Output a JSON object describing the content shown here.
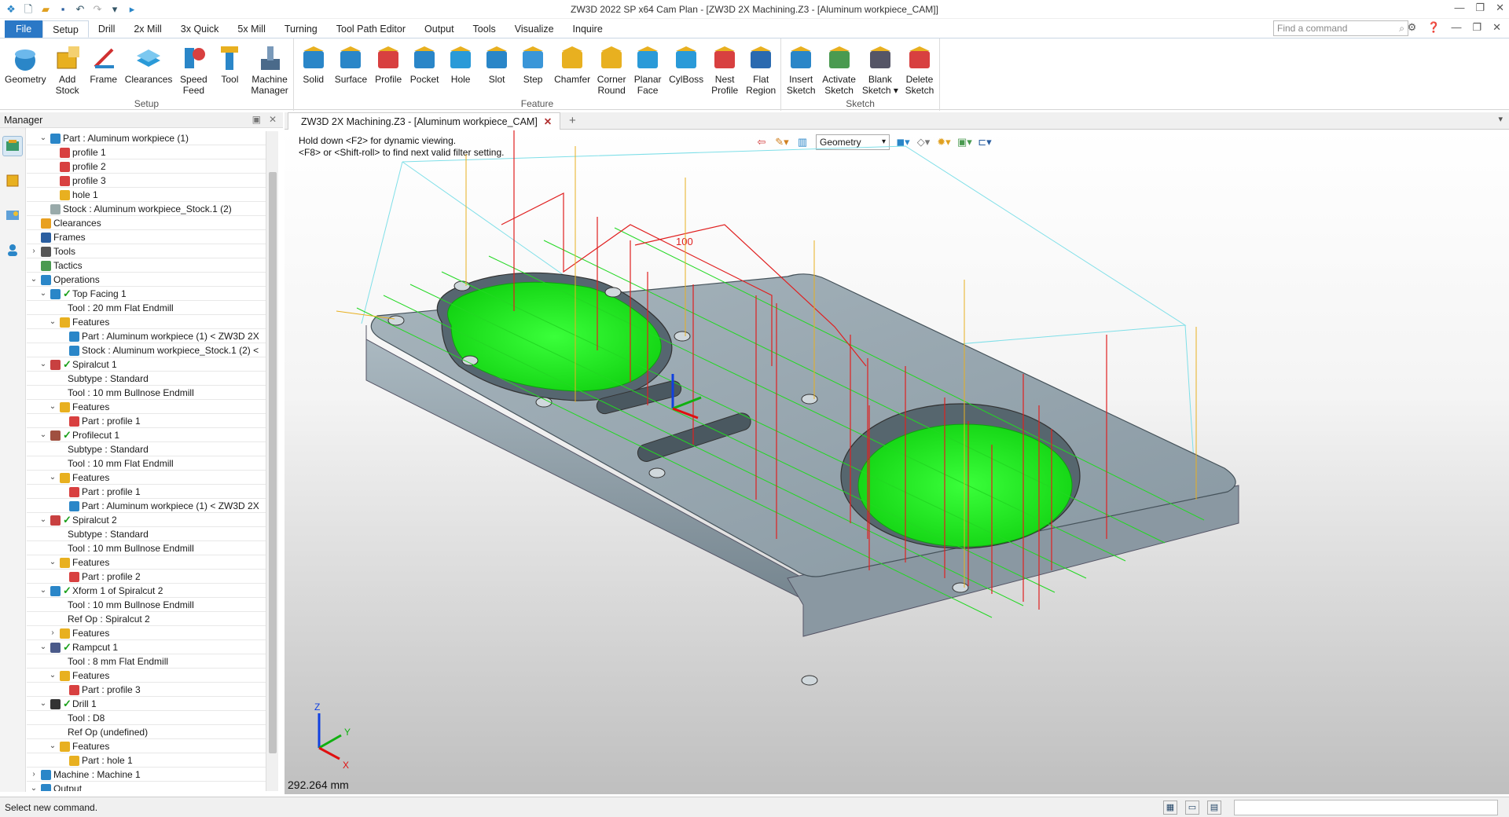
{
  "app": {
    "title": "ZW3D 2022 SP x64          Cam Plan - [ZW3D 2X Machining.Z3 - [Aluminum workpiece_CAM]]"
  },
  "quick_access": [
    "new-file-icon",
    "open-folder-icon",
    "save-icon",
    "undo-icon",
    "redo-icon",
    "dropdown-icon",
    "run-icon"
  ],
  "menu": {
    "tabs": [
      "File",
      "Setup",
      "Drill",
      "2x Mill",
      "3x Quick",
      "5x Mill",
      "Turning",
      "Tool Path Editor",
      "Output",
      "Tools",
      "Visualize",
      "Inquire"
    ],
    "active": "Setup"
  },
  "command_search": {
    "placeholder": "Find a command"
  },
  "ribbon": {
    "groups": [
      {
        "name": "Setup",
        "buttons": [
          "Geometry",
          "Add\nStock",
          "Frame",
          "Clearances",
          "Speed\nFeed",
          "Tool",
          "Machine\nManager"
        ]
      },
      {
        "name": "Feature",
        "buttons": [
          "Solid",
          "Surface",
          "Profile",
          "Pocket",
          "Hole",
          "Slot",
          "Step",
          "Chamfer",
          "Corner\nRound",
          "Planar\nFace",
          "CylBoss",
          "Nest\nProfile",
          "Flat\nRegion"
        ]
      },
      {
        "name": "Sketch",
        "buttons": [
          "Insert\nSketch",
          "Activate\nSketch",
          "Blank\nSketch ▾",
          "Delete\nSketch"
        ]
      }
    ],
    "colors": {
      "primary": "#2a86c8",
      "accent": "#e8a020",
      "sketch": "#d84040"
    }
  },
  "manager": {
    "title": "Manager",
    "tree": [
      {
        "depth": 1,
        "exp": "v",
        "icon": "part",
        "label": "Part : Aluminum workpiece (1)"
      },
      {
        "depth": 2,
        "icon": "profile",
        "label": "profile 1"
      },
      {
        "depth": 2,
        "icon": "profile",
        "label": "profile 2"
      },
      {
        "depth": 2,
        "icon": "profile",
        "label": "profile 3"
      },
      {
        "depth": 2,
        "icon": "hole",
        "label": "hole 1"
      },
      {
        "depth": 1,
        "icon": "stock",
        "label": "Stock : Aluminum workpiece_Stock.1 (2)"
      },
      {
        "depth": 0,
        "icon": "clearance",
        "label": "Clearances"
      },
      {
        "depth": 0,
        "icon": "frame",
        "label": "Frames"
      },
      {
        "depth": 0,
        "exp": ">",
        "icon": "tool",
        "label": "Tools"
      },
      {
        "depth": 0,
        "icon": "tactic",
        "label": "Tactics"
      },
      {
        "depth": 0,
        "exp": "v",
        "icon": "ops",
        "label": "Operations"
      },
      {
        "depth": 1,
        "exp": "v",
        "icon": "facing",
        "check": true,
        "label": "Top Facing 1"
      },
      {
        "depth": 2,
        "label": "Tool : 20 mm Flat Endmill"
      },
      {
        "depth": 2,
        "exp": "v",
        "icon": "feature",
        "label": "Features"
      },
      {
        "depth": 3,
        "icon": "part",
        "label": "Part : Aluminum workpiece (1) < ZW3D 2X"
      },
      {
        "depth": 3,
        "icon": "part",
        "label": "Stock : Aluminum workpiece_Stock.1 (2) <"
      },
      {
        "depth": 1,
        "exp": "v",
        "icon": "spiral",
        "check": true,
        "label": "Spiralcut 1"
      },
      {
        "depth": 2,
        "label": "Subtype : Standard"
      },
      {
        "depth": 2,
        "label": "Tool : 10 mm Bullnose Endmill"
      },
      {
        "depth": 2,
        "exp": "v",
        "icon": "feature",
        "label": "Features"
      },
      {
        "depth": 3,
        "icon": "profile",
        "label": "Part : profile 1"
      },
      {
        "depth": 1,
        "exp": "v",
        "icon": "profilecut",
        "check": true,
        "label": "Profilecut 1"
      },
      {
        "depth": 2,
        "label": "Subtype : Standard"
      },
      {
        "depth": 2,
        "label": "Tool : 10 mm Flat Endmill"
      },
      {
        "depth": 2,
        "exp": "v",
        "icon": "feature",
        "label": "Features"
      },
      {
        "depth": 3,
        "icon": "profile",
        "label": "Part : profile 1"
      },
      {
        "depth": 3,
        "icon": "part",
        "label": "Part : Aluminum workpiece (1) < ZW3D 2X"
      },
      {
        "depth": 1,
        "exp": "v",
        "icon": "spiral",
        "check": true,
        "label": "Spiralcut 2"
      },
      {
        "depth": 2,
        "label": "Subtype : Standard"
      },
      {
        "depth": 2,
        "label": "Tool : 10 mm Bullnose Endmill"
      },
      {
        "depth": 2,
        "exp": "v",
        "icon": "feature",
        "label": "Features"
      },
      {
        "depth": 3,
        "icon": "profile",
        "label": "Part : profile 2"
      },
      {
        "depth": 1,
        "exp": "v",
        "icon": "xform",
        "check": true,
        "label": "Xform 1 of Spiralcut 2"
      },
      {
        "depth": 2,
        "label": "Tool : 10 mm Bullnose Endmill"
      },
      {
        "depth": 2,
        "label": "Ref Op : Spiralcut 2"
      },
      {
        "depth": 2,
        "exp": ">",
        "icon": "feature",
        "label": "Features"
      },
      {
        "depth": 1,
        "exp": "v",
        "icon": "ramp",
        "check": true,
        "label": "Rampcut 1"
      },
      {
        "depth": 2,
        "label": "Tool : 8 mm Flat Endmill"
      },
      {
        "depth": 2,
        "exp": "v",
        "icon": "feature",
        "label": "Features"
      },
      {
        "depth": 3,
        "icon": "profile",
        "label": "Part : profile 3"
      },
      {
        "depth": 1,
        "exp": "v",
        "icon": "drill",
        "check": true,
        "label": "Drill 1"
      },
      {
        "depth": 2,
        "label": "Tool : D8"
      },
      {
        "depth": 2,
        "label": "Ref Op (undefined)"
      },
      {
        "depth": 2,
        "exp": "v",
        "icon": "feature",
        "label": "Features"
      },
      {
        "depth": 3,
        "icon": "hole",
        "label": "Part : hole 1"
      },
      {
        "depth": 0,
        "exp": ">",
        "icon": "machine",
        "label": "Machine : Machine 1"
      },
      {
        "depth": 0,
        "exp": "v",
        "icon": "output",
        "label": "Output"
      }
    ]
  },
  "document": {
    "tab_label": "ZW3D 2X Machining.Z3 - [Aluminum workpiece_CAM]"
  },
  "viewport": {
    "hint_lines": [
      "Hold down <F2> for dynamic viewing.",
      "<F8> or <Shift-roll> to find next valid filter setting."
    ],
    "filter_value": "Geometry",
    "dimension_label": "100",
    "measurement": "292.264 mm",
    "axes": {
      "x": "X",
      "y": "Y",
      "z": "Z"
    },
    "colors": {
      "toolpath": "#22ff22",
      "rapid": "#e02020",
      "stock_box": "#7fdfe8",
      "retract": "#e8b020",
      "part": "#93a4ae"
    }
  },
  "status": {
    "text": "Select new command."
  }
}
